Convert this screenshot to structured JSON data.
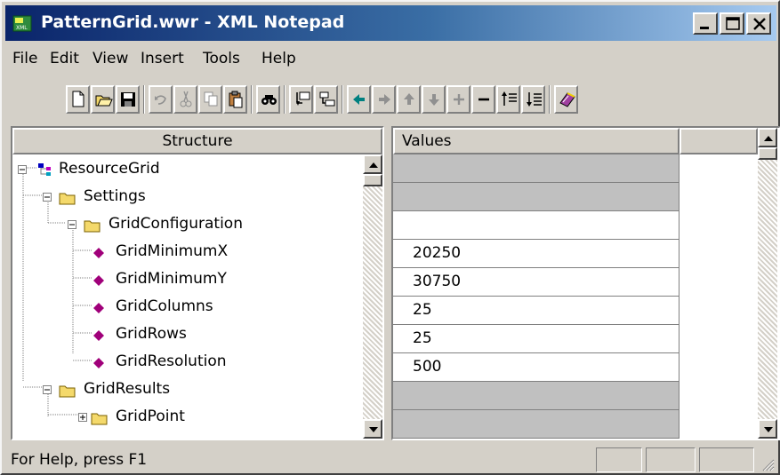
{
  "window": {
    "title": "PatternGrid.wwr - XML Notepad"
  },
  "menu": [
    "File",
    "Edit",
    "View",
    "Insert",
    "Tools",
    "Help"
  ],
  "toolbar": {
    "buttons": [
      "new-icon",
      "open-icon",
      "save-icon",
      "undo-icon",
      "cut-icon",
      "copy-icon",
      "paste-icon",
      "find-icon",
      "insert-element-icon",
      "insert-child-icon",
      "move-left-icon",
      "move-right-icon",
      "move-up-icon",
      "move-down-icon",
      "expand-icon",
      "collapse-icon",
      "expand-all-icon",
      "collapse-all-icon",
      "help-book-icon"
    ]
  },
  "structure": {
    "header": "Structure",
    "nodes": [
      {
        "label": "ResourceGrid",
        "kind": "root",
        "toggle": "minus",
        "depth": 0
      },
      {
        "label": "Settings",
        "kind": "folder",
        "toggle": "minus",
        "depth": 1
      },
      {
        "label": "GridConfiguration",
        "kind": "folder",
        "toggle": "minus",
        "depth": 2
      },
      {
        "label": "GridMinimumX",
        "kind": "leaf",
        "depth": 3
      },
      {
        "label": "GridMinimumY",
        "kind": "leaf",
        "depth": 3
      },
      {
        "label": "GridColumns",
        "kind": "leaf",
        "depth": 3
      },
      {
        "label": "GridRows",
        "kind": "leaf",
        "depth": 3
      },
      {
        "label": "GridResolution",
        "kind": "leaf",
        "depth": 3
      },
      {
        "label": "GridResults",
        "kind": "folder",
        "toggle": "minus",
        "depth": 1
      },
      {
        "label": "GridPoint",
        "kind": "folder",
        "toggle": "plus",
        "depth": 2
      }
    ]
  },
  "values": {
    "header": "Values",
    "cells": [
      {
        "value": "",
        "shade": "gray"
      },
      {
        "value": "",
        "shade": "gray"
      },
      {
        "value": "",
        "shade": "white"
      },
      {
        "value": "20250",
        "shade": "white"
      },
      {
        "value": "30750",
        "shade": "white"
      },
      {
        "value": "25",
        "shade": "white"
      },
      {
        "value": "25",
        "shade": "white"
      },
      {
        "value": "500",
        "shade": "white"
      },
      {
        "value": "",
        "shade": "gray"
      },
      {
        "value": "",
        "shade": "gray"
      }
    ]
  },
  "status": {
    "text": "For Help, press F1"
  },
  "colors": {
    "title_start": "#0a246a",
    "title_end": "#a6caf0",
    "folder": "#f4d96b",
    "leaf_diamond": "#a0007a",
    "face": "#d4d0c8"
  }
}
